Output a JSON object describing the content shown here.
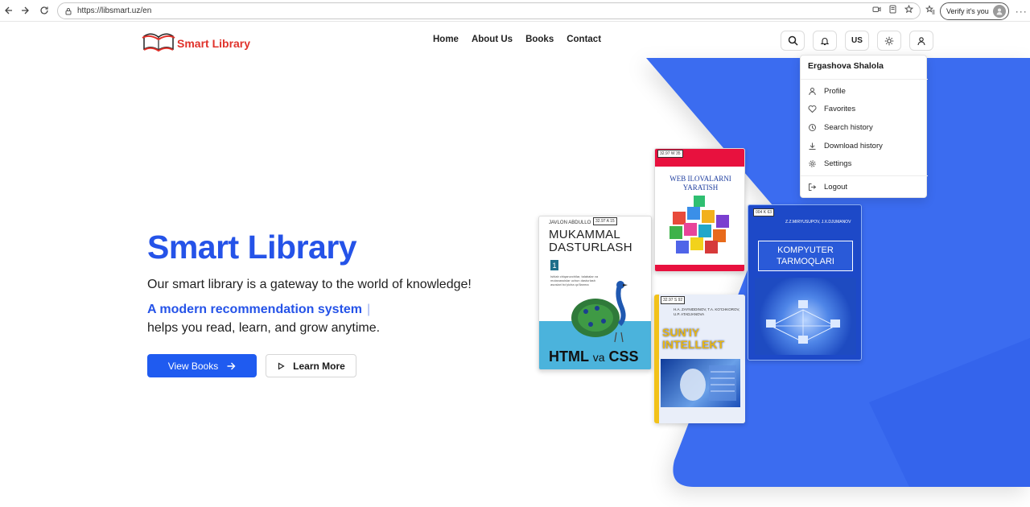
{
  "browser": {
    "url": "https://libsmart.uz/en",
    "verify_label": "Verify it's you"
  },
  "header": {
    "logo_text": "Smart Library",
    "nav": [
      {
        "label": "Home"
      },
      {
        "label": "About Us"
      },
      {
        "label": "Books"
      },
      {
        "label": "Contact"
      }
    ],
    "language": "US"
  },
  "hero": {
    "title": "Smart Library",
    "subtitle": "Our smart library is a gateway to the world of knowledge!",
    "accent": "A modern recommendation system",
    "cursor": "|",
    "description": "helps you read, learn, and grow anytime.",
    "primary_button": "View Books",
    "secondary_button": "Learn More"
  },
  "books": [
    {
      "author": "JAVLON ABDULLO",
      "title_line1": "MUKAMMAL",
      "title_line2": "DASTURLASH",
      "volume": "1",
      "small_text": "Ishlab chiqaruvchilar, talabalar va mutaxassislar uchun dasturlash asoslari bo'yicha qo'llanma",
      "bottom_title": "HTML",
      "bottom_va": "va",
      "bottom_css": "CSS",
      "sticker": "32.97 A 15"
    },
    {
      "title_line1": "WEB ILOVALARNI",
      "title_line2": "YARATISH",
      "sticker": "32.97 W 35"
    },
    {
      "authors": "H.A. ZAYNIDDINOV, T.A. KO'CHKOROV, U.P. ATADJANOVA",
      "title_line1": "SUN'IY",
      "title_line2": "INTELLEKT",
      "sticker": "32.97 S 92"
    },
    {
      "authors": "Z.Z.MIRYUSUPOV, J.X.DJUMANOV",
      "title_line1": "KOMPYUTER",
      "title_line2": "TARMOQLARI",
      "sticker": "004 K 63"
    }
  ],
  "dropdown": {
    "user_name": "Ergashova Shalola",
    "items": [
      {
        "label": "Profile",
        "icon": "user-icon"
      },
      {
        "label": "Favorites",
        "icon": "heart-icon"
      },
      {
        "label": "Search history",
        "icon": "history-icon"
      },
      {
        "label": "Download history",
        "icon": "download-icon"
      },
      {
        "label": "Settings",
        "icon": "gear-icon"
      }
    ],
    "logout": {
      "label": "Logout",
      "icon": "logout-icon"
    }
  },
  "colors": {
    "brand_blue": "#2553e8",
    "button_blue": "#1f5bf0",
    "logo_red": "#e0322b",
    "hero_shape": "#3a6cf0"
  }
}
